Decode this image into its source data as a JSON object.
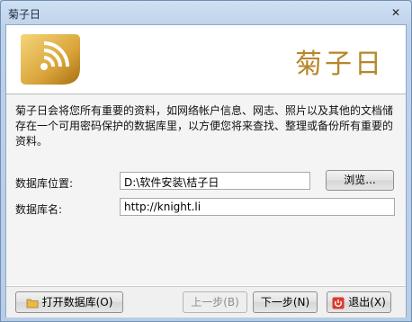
{
  "window": {
    "title": "菊子日",
    "close_glyph": "✕"
  },
  "banner": {
    "brand_text": "菊子日"
  },
  "description": "菊子日会将您所有重要的资料，如网络帐户信息、网志、照片以及其他的文档储存在一个可用密码保护的数据库里，以方便您将来查找、整理或备份所有重要的资料。",
  "form": {
    "location_label": "数据库位置:",
    "location_value": "D:\\软件安装\\桔子日",
    "browse_label": "浏览...",
    "name_label": "数据库名:",
    "name_value": "http://knight.li"
  },
  "footer": {
    "open_db_label": "打开数据库(O)",
    "prev_label": "上一步(B)",
    "next_label": "下一步(N)",
    "exit_label": "退出(X)"
  },
  "colors": {
    "brand": "#b7862a",
    "logo_gold": "#d9a53a",
    "exit_red": "#d93a2b"
  },
  "icons": {
    "logo": "rss-feed-logo-icon",
    "open_db": "folder-icon",
    "exit": "power-icon"
  }
}
